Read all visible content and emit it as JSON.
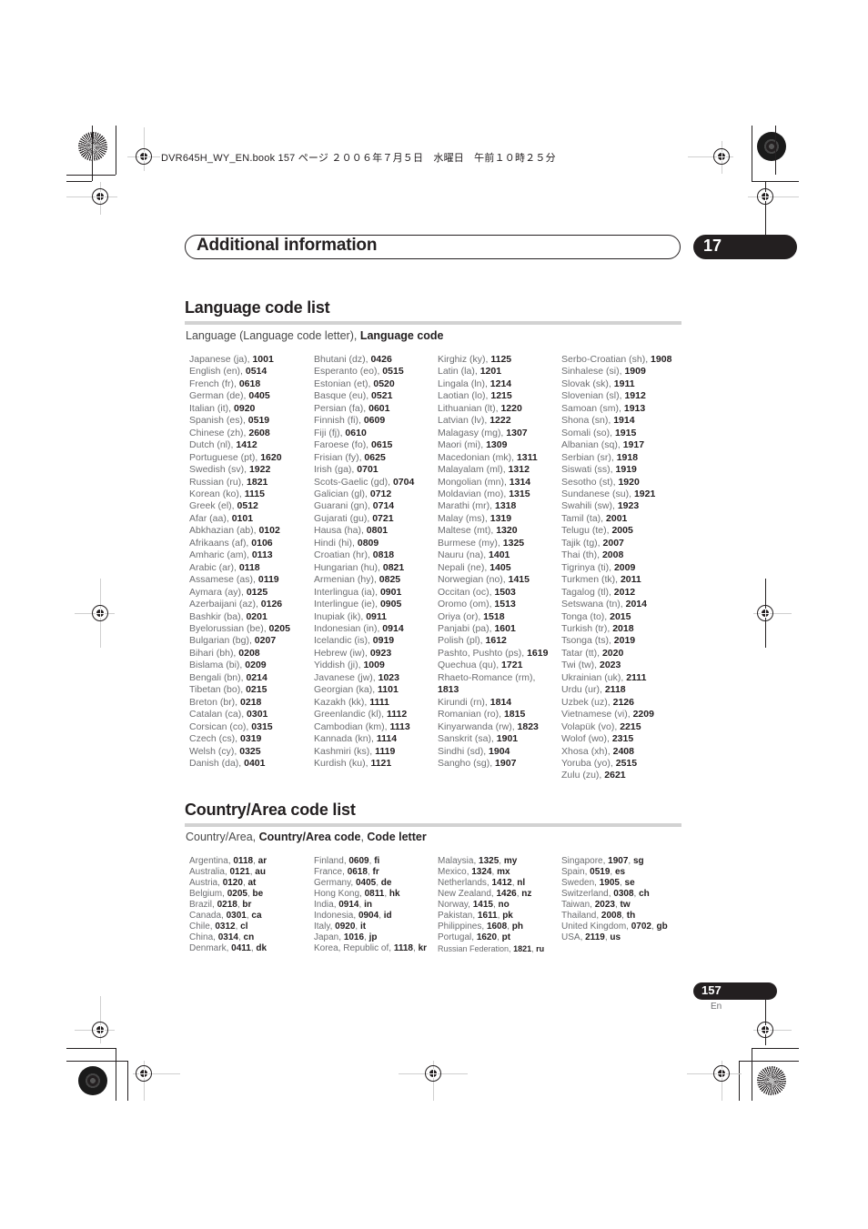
{
  "header_slug": "DVR645H_WY_EN.book 157 ページ ２００６年７月５日　水曜日　午前１０時２５分",
  "chapter": {
    "title": "Additional information",
    "number": "17"
  },
  "language_section": {
    "title": "Language code list",
    "subtitle_plain": "Language (Language code letter), ",
    "subtitle_bold": "Language code",
    "columns": [
      [
        {
          "name": "Japanese (ja), ",
          "code": "1001"
        },
        {
          "name": "English (en), ",
          "code": "0514"
        },
        {
          "name": "French (fr), ",
          "code": "0618"
        },
        {
          "name": "German (de), ",
          "code": "0405"
        },
        {
          "name": "Italian (it), ",
          "code": "0920"
        },
        {
          "name": "Spanish (es), ",
          "code": "0519"
        },
        {
          "name": "Chinese (zh), ",
          "code": "2608"
        },
        {
          "name": "Dutch (nl), ",
          "code": "1412"
        },
        {
          "name": "Portuguese (pt), ",
          "code": "1620"
        },
        {
          "name": "Swedish (sv), ",
          "code": "1922"
        },
        {
          "name": "Russian (ru), ",
          "code": "1821"
        },
        {
          "name": "Korean (ko), ",
          "code": "1115"
        },
        {
          "name": "Greek (el), ",
          "code": "0512"
        },
        {
          "name": "Afar (aa), ",
          "code": "0101"
        },
        {
          "name": "Abkhazian (ab), ",
          "code": "0102"
        },
        {
          "name": "Afrikaans (af), ",
          "code": "0106"
        },
        {
          "name": "Amharic (am), ",
          "code": "0113"
        },
        {
          "name": "Arabic (ar), ",
          "code": "0118"
        },
        {
          "name": "Assamese (as), ",
          "code": "0119"
        },
        {
          "name": "Aymara (ay), ",
          "code": "0125"
        },
        {
          "name": "Azerbaijani (az), ",
          "code": "0126"
        },
        {
          "name": "Bashkir (ba), ",
          "code": "0201"
        },
        {
          "name": "Byelorussian (be), ",
          "code": "0205"
        },
        {
          "name": "Bulgarian (bg), ",
          "code": "0207"
        },
        {
          "name": "Bihari (bh), ",
          "code": "0208"
        },
        {
          "name": "Bislama (bi), ",
          "code": "0209"
        },
        {
          "name": "Bengali (bn), ",
          "code": "0214"
        },
        {
          "name": "Tibetan (bo), ",
          "code": "0215"
        },
        {
          "name": "Breton (br), ",
          "code": "0218"
        },
        {
          "name": "Catalan (ca), ",
          "code": "0301"
        },
        {
          "name": "Corsican (co), ",
          "code": "0315"
        },
        {
          "name": "Czech (cs), ",
          "code": "0319"
        },
        {
          "name": "Welsh (cy), ",
          "code": "0325"
        },
        {
          "name": "Danish (da), ",
          "code": "0401"
        }
      ],
      [
        {
          "name": "Bhutani (dz), ",
          "code": "0426"
        },
        {
          "name": "Esperanto (eo), ",
          "code": "0515"
        },
        {
          "name": "Estonian (et), ",
          "code": "0520"
        },
        {
          "name": "Basque (eu), ",
          "code": "0521"
        },
        {
          "name": "Persian (fa), ",
          "code": "0601"
        },
        {
          "name": "Finnish (fi), ",
          "code": "0609"
        },
        {
          "name": "Fiji (fj), ",
          "code": "0610"
        },
        {
          "name": "Faroese (fo), ",
          "code": "0615"
        },
        {
          "name": "Frisian (fy), ",
          "code": "0625"
        },
        {
          "name": "Irish (ga), ",
          "code": "0701"
        },
        {
          "name": "Scots-Gaelic (gd), ",
          "code": "0704"
        },
        {
          "name": "Galician (gl), ",
          "code": "0712"
        },
        {
          "name": "Guarani (gn), ",
          "code": "0714"
        },
        {
          "name": "Gujarati (gu), ",
          "code": "0721"
        },
        {
          "name": "Hausa (ha), ",
          "code": "0801"
        },
        {
          "name": "Hindi (hi), ",
          "code": "0809"
        },
        {
          "name": "Croatian (hr), ",
          "code": "0818"
        },
        {
          "name": "Hungarian (hu), ",
          "code": "0821"
        },
        {
          "name": "Armenian (hy), ",
          "code": "0825"
        },
        {
          "name": "Interlingua (ia), ",
          "code": "0901"
        },
        {
          "name": "Interlingue (ie), ",
          "code": "0905"
        },
        {
          "name": "Inupiak (ik), ",
          "code": "0911"
        },
        {
          "name": "Indonesian (in), ",
          "code": "0914"
        },
        {
          "name": "Icelandic (is), ",
          "code": "0919"
        },
        {
          "name": "Hebrew (iw), ",
          "code": "0923"
        },
        {
          "name": "Yiddish (ji), ",
          "code": "1009"
        },
        {
          "name": "Javanese (jw), ",
          "code": "1023"
        },
        {
          "name": "Georgian (ka), ",
          "code": "1101"
        },
        {
          "name": "Kazakh (kk), ",
          "code": "1111"
        },
        {
          "name": "Greenlandic (kl), ",
          "code": "1112"
        },
        {
          "name": "Cambodian (km), ",
          "code": "1113"
        },
        {
          "name": "Kannada (kn), ",
          "code": "1114"
        },
        {
          "name": "Kashmiri (ks), ",
          "code": "1119"
        },
        {
          "name": "Kurdish (ku), ",
          "code": "1121"
        }
      ],
      [
        {
          "name": "Kirghiz (ky), ",
          "code": "1125"
        },
        {
          "name": "Latin (la), ",
          "code": "1201"
        },
        {
          "name": "Lingala (ln), ",
          "code": "1214"
        },
        {
          "name": "Laotian (lo), ",
          "code": "1215"
        },
        {
          "name": "Lithuanian (lt), ",
          "code": "1220"
        },
        {
          "name": "Latvian (lv), ",
          "code": "1222"
        },
        {
          "name": "Malagasy (mg), ",
          "code": "1307"
        },
        {
          "name": "Maori (mi), ",
          "code": "1309"
        },
        {
          "name": "Macedonian (mk), ",
          "code": "1311"
        },
        {
          "name": "Malayalam (ml), ",
          "code": "1312"
        },
        {
          "name": "Mongolian (mn), ",
          "code": "1314"
        },
        {
          "name": "Moldavian (mo), ",
          "code": "1315"
        },
        {
          "name": "Marathi (mr), ",
          "code": "1318"
        },
        {
          "name": "Malay (ms), ",
          "code": "1319"
        },
        {
          "name": "Maltese (mt), ",
          "code": "1320"
        },
        {
          "name": "Burmese (my), ",
          "code": "1325"
        },
        {
          "name": "Nauru (na), ",
          "code": "1401"
        },
        {
          "name": "Nepali (ne), ",
          "code": "1405"
        },
        {
          "name": "Norwegian (no), ",
          "code": "1415"
        },
        {
          "name": "Occitan (oc), ",
          "code": "1503"
        },
        {
          "name": "Oromo (om), ",
          "code": "1513"
        },
        {
          "name": "Oriya (or), ",
          "code": "1518"
        },
        {
          "name": "Panjabi (pa), ",
          "code": "1601"
        },
        {
          "name": "Polish (pl), ",
          "code": "1612"
        },
        {
          "name": "Pashto, Pushto (ps), ",
          "code": "1619"
        },
        {
          "name": "Quechua (qu), ",
          "code": "1721"
        },
        {
          "name": "Rhaeto-Romance (rm),",
          "code": "1813",
          "wrap": true
        },
        {
          "name": "Kirundi (rn), ",
          "code": "1814"
        },
        {
          "name": "Romanian (ro), ",
          "code": "1815"
        },
        {
          "name": "Kinyarwanda (rw), ",
          "code": "1823"
        },
        {
          "name": "Sanskrit (sa), ",
          "code": "1901"
        },
        {
          "name": "Sindhi (sd), ",
          "code": "1904"
        },
        {
          "name": "Sangho (sg), ",
          "code": "1907"
        }
      ],
      [
        {
          "name": "Serbo-Croatian (sh), ",
          "code": "1908"
        },
        {
          "name": "Sinhalese (si), ",
          "code": "1909"
        },
        {
          "name": "Slovak (sk), ",
          "code": "1911"
        },
        {
          "name": "Slovenian (sl), ",
          "code": "1912"
        },
        {
          "name": "Samoan (sm), ",
          "code": "1913"
        },
        {
          "name": "Shona (sn), ",
          "code": "1914"
        },
        {
          "name": "Somali (so), ",
          "code": "1915"
        },
        {
          "name": "Albanian (sq), ",
          "code": "1917"
        },
        {
          "name": "Serbian (sr), ",
          "code": "1918"
        },
        {
          "name": "Siswati (ss), ",
          "code": "1919"
        },
        {
          "name": "Sesotho (st), ",
          "code": "1920"
        },
        {
          "name": "Sundanese (su), ",
          "code": "1921"
        },
        {
          "name": "Swahili (sw), ",
          "code": "1923"
        },
        {
          "name": "Tamil (ta), ",
          "code": "2001"
        },
        {
          "name": "Telugu (te), ",
          "code": "2005"
        },
        {
          "name": "Tajik (tg), ",
          "code": "2007"
        },
        {
          "name": "Thai (th), ",
          "code": "2008"
        },
        {
          "name": "Tigrinya (ti), ",
          "code": "2009"
        },
        {
          "name": "Turkmen (tk), ",
          "code": "2011"
        },
        {
          "name": "Tagalog (tl), ",
          "code": "2012"
        },
        {
          "name": "Setswana (tn), ",
          "code": "2014"
        },
        {
          "name": "Tonga (to), ",
          "code": "2015"
        },
        {
          "name": "Turkish (tr), ",
          "code": "2018"
        },
        {
          "name": "Tsonga (ts), ",
          "code": "2019"
        },
        {
          "name": "Tatar (tt), ",
          "code": "2020"
        },
        {
          "name": "Twi (tw), ",
          "code": "2023"
        },
        {
          "name": "Ukrainian (uk), ",
          "code": "2111"
        },
        {
          "name": "Urdu (ur), ",
          "code": "2118"
        },
        {
          "name": "Uzbek (uz), ",
          "code": "2126"
        },
        {
          "name": "Vietnamese (vi), ",
          "code": "2209"
        },
        {
          "name": "Volapük (vo), ",
          "code": "2215"
        },
        {
          "name": "Wolof (wo), ",
          "code": "2315"
        },
        {
          "name": "Xhosa (xh), ",
          "code": "2408"
        },
        {
          "name": "Yoruba (yo), ",
          "code": "2515"
        },
        {
          "name": "Zulu (zu), ",
          "code": "2621"
        }
      ]
    ]
  },
  "country_section": {
    "title": "Country/Area code list",
    "subtitle_plain": "Country/Area, ",
    "subtitle_bold1": "Country/Area code",
    "subtitle_sep": ", ",
    "subtitle_bold2": "Code letter",
    "columns": [
      [
        {
          "name": "Argentina",
          "code": "0118",
          "letter": "ar"
        },
        {
          "name": "Australia",
          "code": "0121",
          "letter": "au"
        },
        {
          "name": "Austria",
          "code": "0120",
          "letter": "at"
        },
        {
          "name": "Belgium",
          "code": "0205",
          "letter": "be"
        },
        {
          "name": "Brazil",
          "code": "0218",
          "letter": "br"
        },
        {
          "name": "Canada",
          "code": "0301",
          "letter": "ca"
        },
        {
          "name": "Chile",
          "code": "0312",
          "letter": "cl"
        },
        {
          "name": "China",
          "code": "0314",
          "letter": "cn"
        },
        {
          "name": "Denmark",
          "code": "0411",
          "letter": "dk"
        }
      ],
      [
        {
          "name": "Finland",
          "code": "0609",
          "letter": "fi"
        },
        {
          "name": "France",
          "code": "0618",
          "letter": "fr"
        },
        {
          "name": "Germany",
          "code": "0405",
          "letter": "de"
        },
        {
          "name": "Hong Kong",
          "code": "0811",
          "letter": "hk"
        },
        {
          "name": "India",
          "code": "0914",
          "letter": "in"
        },
        {
          "name": "Indonesia",
          "code": "0904",
          "letter": "id"
        },
        {
          "name": "Italy",
          "code": "0920",
          "letter": "it"
        },
        {
          "name": "Japan",
          "code": "1016",
          "letter": "jp"
        },
        {
          "name": "Korea, Republic of",
          "code": "1118",
          "letter": "kr"
        }
      ],
      [
        {
          "name": "Malaysia",
          "code": "1325",
          "letter": "my"
        },
        {
          "name": "Mexico",
          "code": "1324",
          "letter": "mx"
        },
        {
          "name": "Netherlands",
          "code": "1412",
          "letter": "nl"
        },
        {
          "name": "New Zealand",
          "code": "1426",
          "letter": "nz"
        },
        {
          "name": "Norway",
          "code": "1415",
          "letter": "no"
        },
        {
          "name": "Pakistan",
          "code": "1611",
          "letter": "pk"
        },
        {
          "name": "Philippines",
          "code": "1608",
          "letter": "ph"
        },
        {
          "name": "Portugal",
          "code": "1620",
          "letter": "pt"
        },
        {
          "name": "Russian Federation",
          "code": "1821",
          "letter": "ru",
          "small": true
        }
      ],
      [
        {
          "name": "Singapore",
          "code": "1907",
          "letter": "sg"
        },
        {
          "name": "Spain",
          "code": "0519",
          "letter": "es"
        },
        {
          "name": "Sweden",
          "code": "1905",
          "letter": "se"
        },
        {
          "name": "Switzerland",
          "code": "0308",
          "letter": "ch"
        },
        {
          "name": "Taiwan",
          "code": "2023",
          "letter": "tw"
        },
        {
          "name": "Thailand",
          "code": "2008",
          "letter": "th"
        },
        {
          "name": "United Kingdom",
          "code": "0702",
          "letter": "gb"
        },
        {
          "name": "USA",
          "code": "2119",
          "letter": "us"
        }
      ]
    ]
  },
  "footer": {
    "page_number": "157",
    "language": "En"
  }
}
